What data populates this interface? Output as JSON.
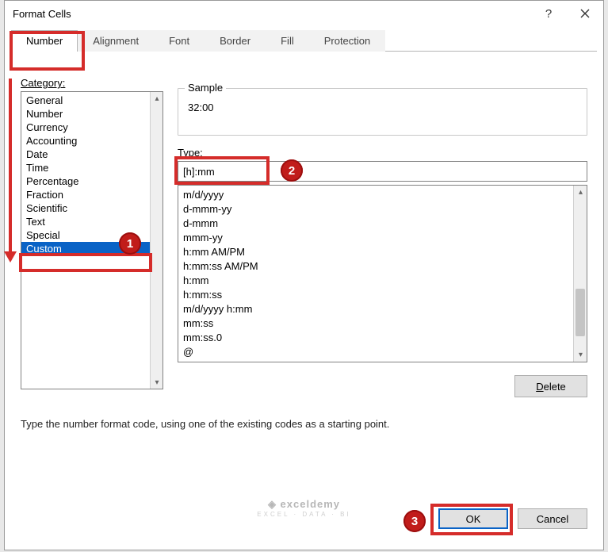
{
  "window": {
    "title": "Format Cells"
  },
  "tabs": [
    {
      "label": "Number",
      "active": true
    },
    {
      "label": "Alignment",
      "active": false
    },
    {
      "label": "Font",
      "active": false
    },
    {
      "label": "Border",
      "active": false
    },
    {
      "label": "Fill",
      "active": false
    },
    {
      "label": "Protection",
      "active": false
    }
  ],
  "category": {
    "label": "Category:",
    "items": [
      "General",
      "Number",
      "Currency",
      "Accounting",
      "Date",
      "Time",
      "Percentage",
      "Fraction",
      "Scientific",
      "Text",
      "Special",
      "Custom"
    ],
    "selected": "Custom"
  },
  "sample": {
    "legend": "Sample",
    "value": "32:00"
  },
  "type": {
    "label": "Type:",
    "value": "[h]:mm",
    "visible_items": [
      "m/d/yyyy",
      "d-mmm-yy",
      "d-mmm",
      "mmm-yy",
      "h:mm AM/PM",
      "h:mm:ss AM/PM",
      "h:mm",
      "h:mm:ss",
      "m/d/yyyy h:mm",
      "mm:ss",
      "mm:ss.0",
      "@"
    ]
  },
  "buttons": {
    "delete": "Delete",
    "ok": "OK",
    "cancel": "Cancel"
  },
  "hint": "Type the number format code, using one of the existing codes as a starting point.",
  "annotations": {
    "badge1": "1",
    "badge2": "2",
    "badge3": "3"
  },
  "watermark": {
    "brand": "exceldemy",
    "tag": "EXCEL · DATA · BI"
  }
}
